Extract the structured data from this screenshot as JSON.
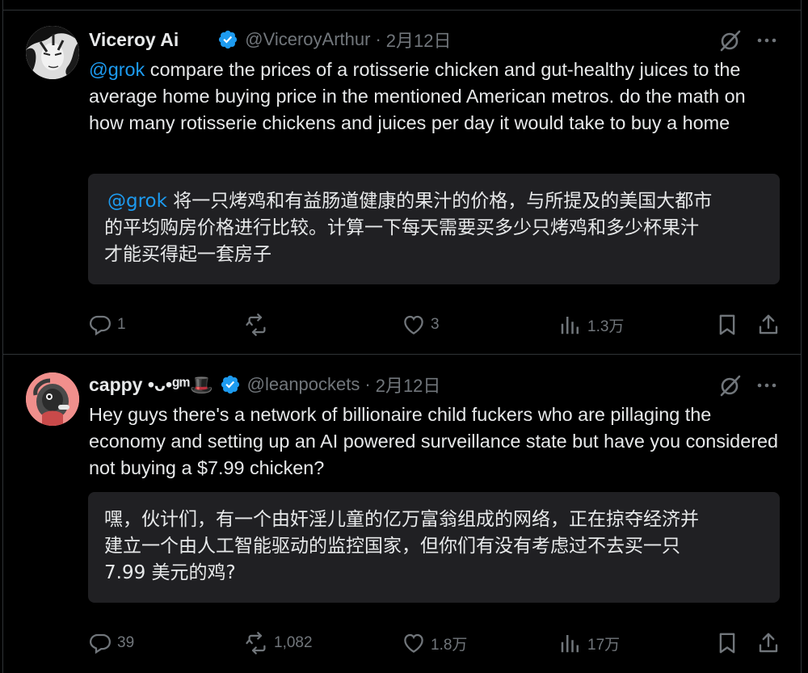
{
  "tweets": [
    {
      "name": "Viceroy Ai",
      "handle": "@ViceroyArthur",
      "dot": "·",
      "date": "2月12日",
      "mention": "@grok",
      "text": " compare the prices of a rotisserie chicken and gut-healthy juices to the average home buying price in the mentioned American metros. do the math on how many rotisserie chickens and juices per day it would take to buy a home",
      "translation_mention": "@grok",
      "translation_line1": " 将一只烤鸡和有益肠道健康的果汁的价格，与所提及的美国大都市",
      "translation_line2": "的平均购房价格进行比较。计算一下每天需要买多少只烤鸡和多少杯果汁",
      "translation_line3": "才能买得起一套房子",
      "stats": {
        "replies": "1",
        "reposts": "",
        "likes": "3",
        "views": "1.3万"
      }
    },
    {
      "name": "cappy •ᴗ•ᵍᵐ🎩",
      "handle": "@leanpockets",
      "dot": "·",
      "date": "2月12日",
      "mention": "",
      "text": "Hey guys there's a network of billionaire child fuckers who are pillaging the economy and setting up an AI powered surveillance state but have you considered not buying a $7.99 chicken?",
      "translation_mention": "",
      "translation_line1": "嘿，伙计们，有一个由奸淫儿童的亿万富翁组成的网络，正在掠夺经济并",
      "translation_line2": "建立一个由人工智能驱动的监控国家，但你们有没有考虑过不去买一只",
      "translation_line3": "7.99 美元的鸡?",
      "stats": {
        "replies": "39",
        "reposts": "1,082",
        "likes": "1.8万",
        "views": "17万"
      }
    }
  ],
  "icons": {
    "verified": "verified-badge-icon",
    "grok": "grok-icon",
    "more": "more-icon",
    "reply": "reply-icon",
    "repost": "repost-icon",
    "like": "like-icon",
    "views": "views-icon",
    "bookmark": "bookmark-icon",
    "share": "share-icon"
  },
  "colors": {
    "background": "#000000",
    "text": "#e7e9ea",
    "muted": "#71767b",
    "accent": "#1d9bf0",
    "translation_bg": "#202023"
  }
}
